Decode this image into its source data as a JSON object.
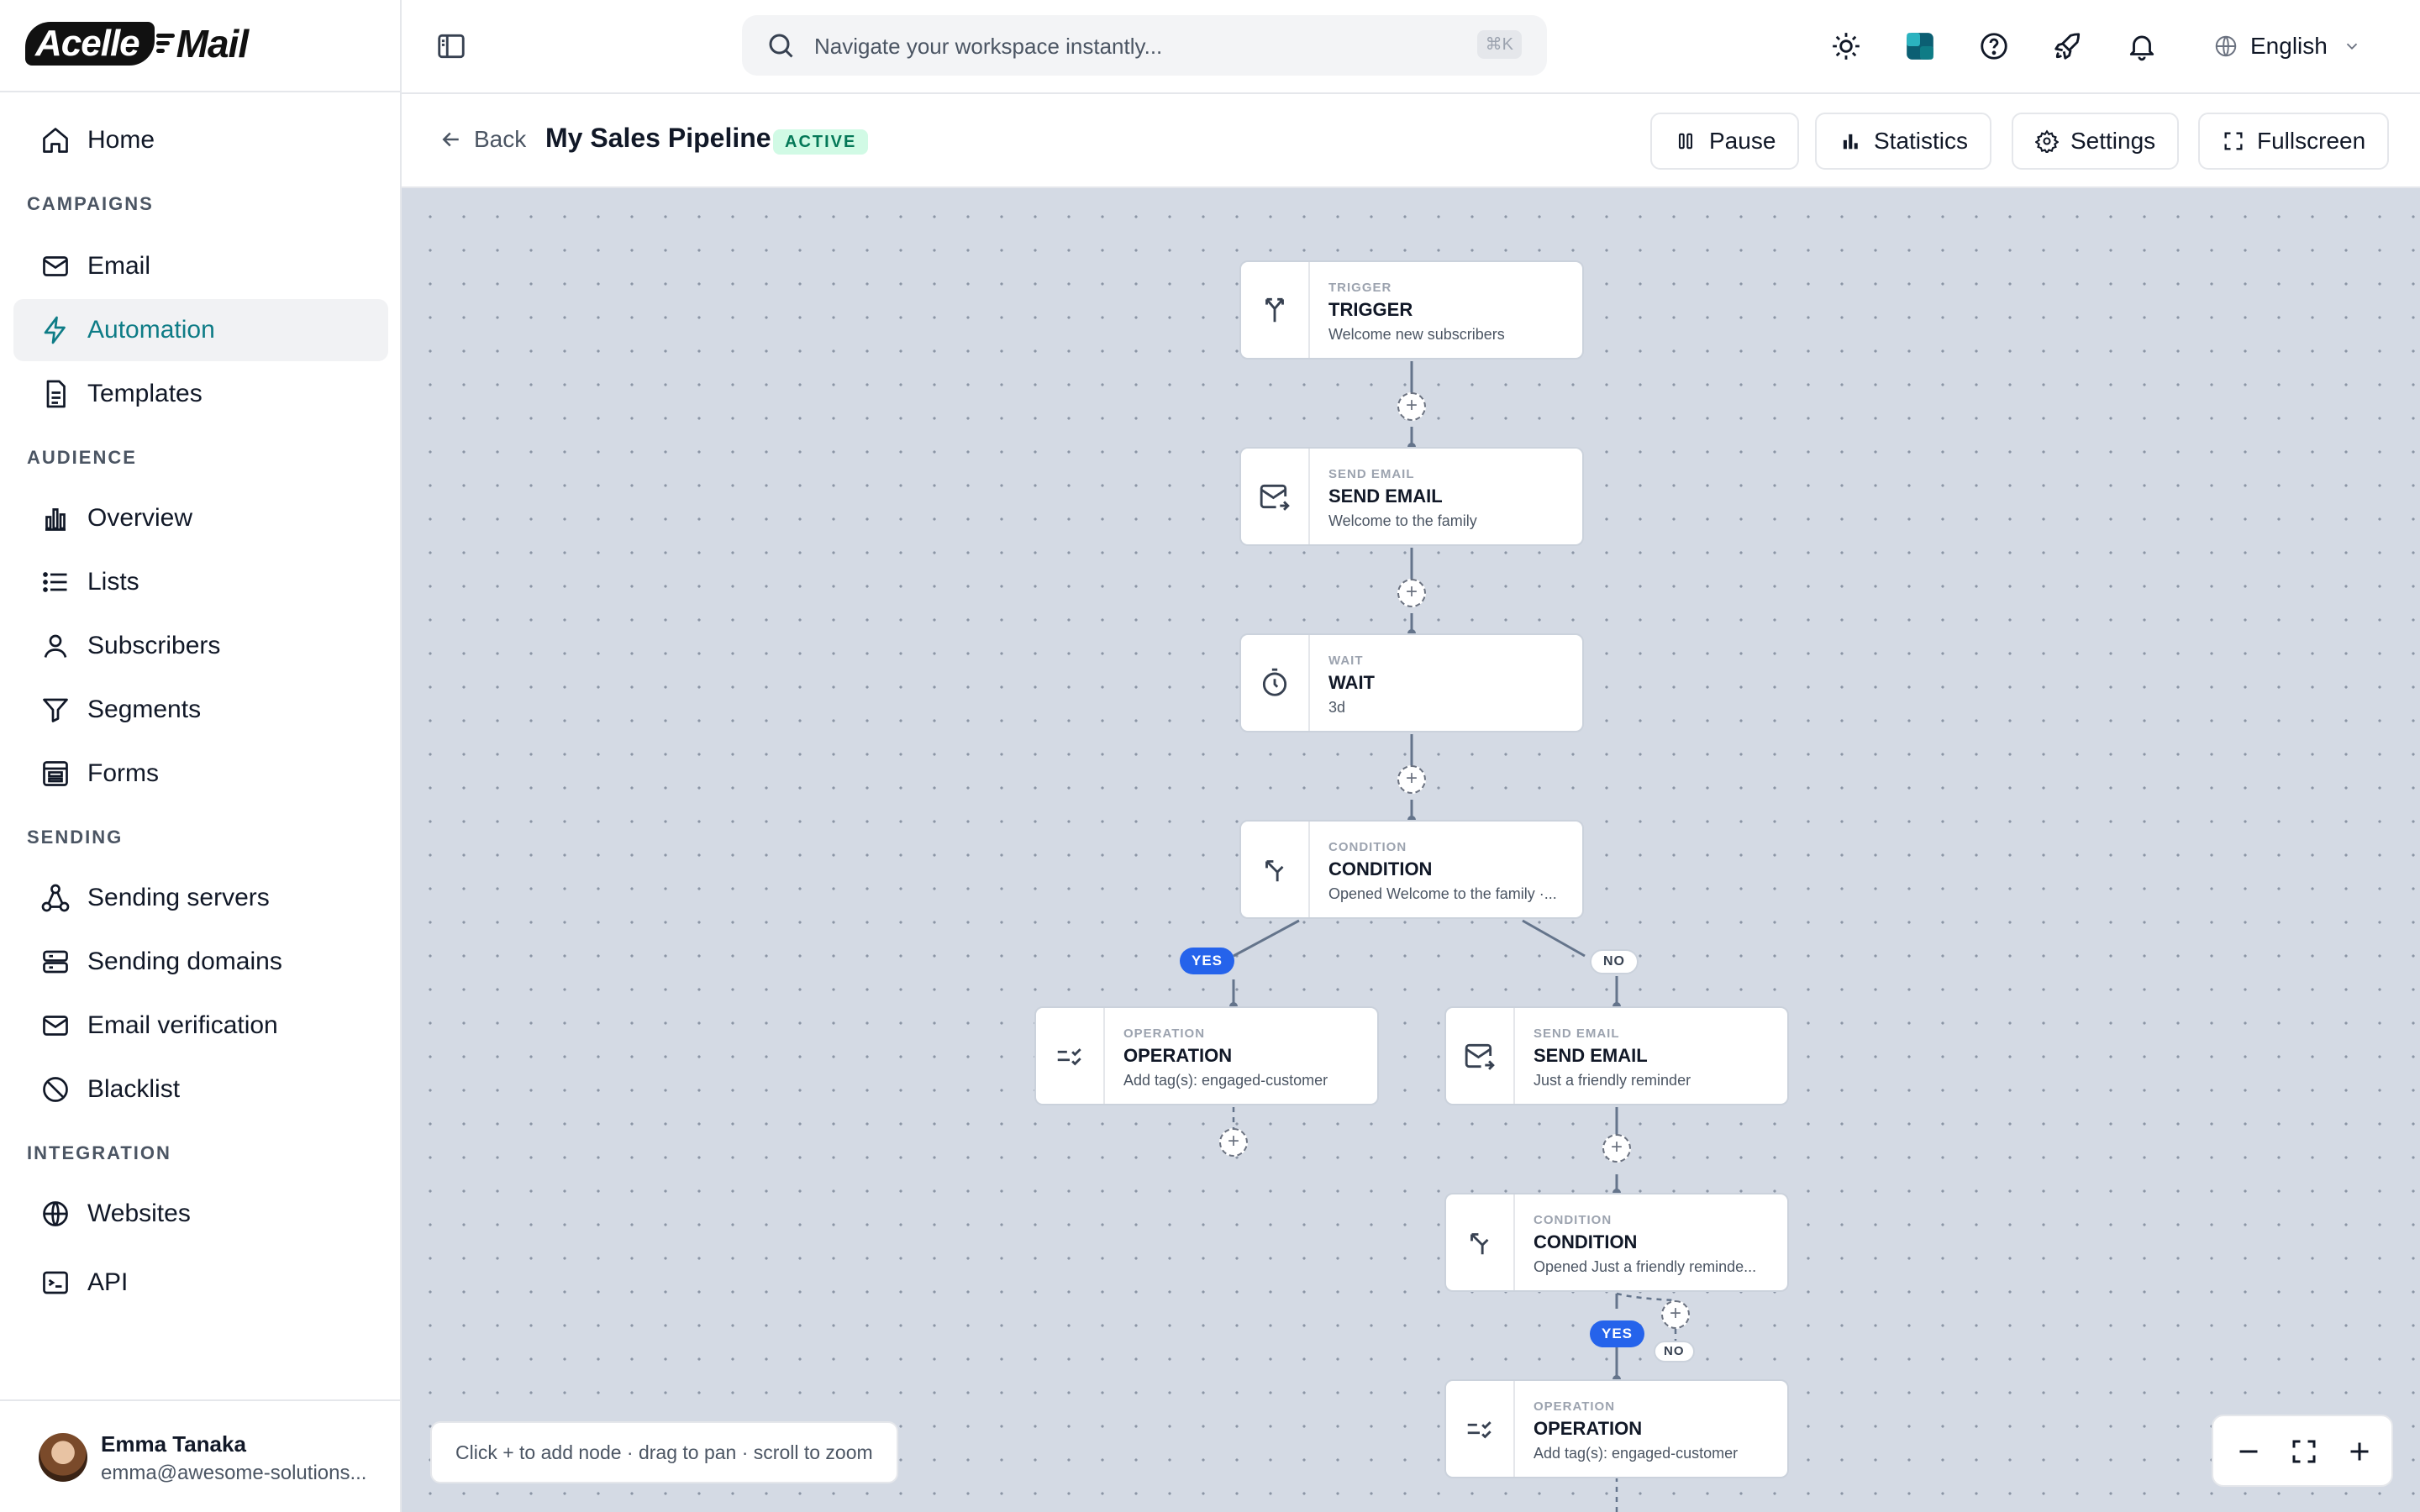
{
  "brand": {
    "logo_left": "Acelle",
    "logo_right": "Mail"
  },
  "sidebar": {
    "home": "Home",
    "sections": {
      "campaigns": "CAMPAIGNS",
      "audience": "AUDIENCE",
      "sending": "SENDING",
      "integration": "INTEGRATION"
    },
    "items": {
      "email": "Email",
      "automation": "Automation",
      "templates": "Templates",
      "overview": "Overview",
      "lists": "Lists",
      "subscribers": "Subscribers",
      "segments": "Segments",
      "forms": "Forms",
      "sending_servers": "Sending servers",
      "sending_domains": "Sending domains",
      "email_verification": "Email verification",
      "blacklist": "Blacklist",
      "websites": "Websites",
      "api": "API"
    },
    "active_item": "automation",
    "user": {
      "name": "Emma Tanaka",
      "email": "emma@awesome-solutions..."
    }
  },
  "topbar": {
    "search_placeholder": "Navigate your workspace instantly...",
    "search_shortcut": "⌘K",
    "language": "English"
  },
  "header": {
    "back_label": "Back",
    "title": "My Sales Pipeline",
    "status": "ACTIVE",
    "buttons": {
      "pause": "Pause",
      "statistics": "Statistics",
      "settings": "Settings",
      "fullscreen": "Fullscreen"
    }
  },
  "flow": {
    "nodes": [
      {
        "type": "TRIGGER",
        "title": "TRIGGER",
        "desc": "Welcome new subscribers",
        "icon": "trigger-icon"
      },
      {
        "type": "SEND EMAIL",
        "title": "SEND EMAIL",
        "desc": "Welcome to the family",
        "icon": "send-email-icon"
      },
      {
        "type": "WAIT",
        "title": "WAIT",
        "desc": "3d",
        "icon": "timer-icon"
      },
      {
        "type": "CONDITION",
        "title": "CONDITION",
        "desc": "Opened Welcome to the family ·...",
        "icon": "condition-icon"
      },
      {
        "type": "OPERATION",
        "title": "OPERATION",
        "desc": "Add tag(s): engaged-customer",
        "icon": "operation-icon"
      },
      {
        "type": "SEND EMAIL",
        "title": "SEND EMAIL",
        "desc": "Just a friendly reminder",
        "icon": "send-email-icon"
      },
      {
        "type": "CONDITION",
        "title": "CONDITION",
        "desc": "Opened Just a friendly reminde...",
        "icon": "condition-icon"
      },
      {
        "type": "OPERATION",
        "title": "OPERATION",
        "desc": "Add tag(s): engaged-customer",
        "icon": "operation-icon"
      }
    ],
    "branch_yes": "YES",
    "branch_no": "NO",
    "add_symbol": "+"
  },
  "canvas_hint": "Click + to add node · drag to pan · scroll to zoom",
  "colors": {
    "accent": "#0e7c86",
    "yes": "#2563eb",
    "active_badge_bg": "#d1fae5",
    "active_badge_fg": "#047857"
  }
}
